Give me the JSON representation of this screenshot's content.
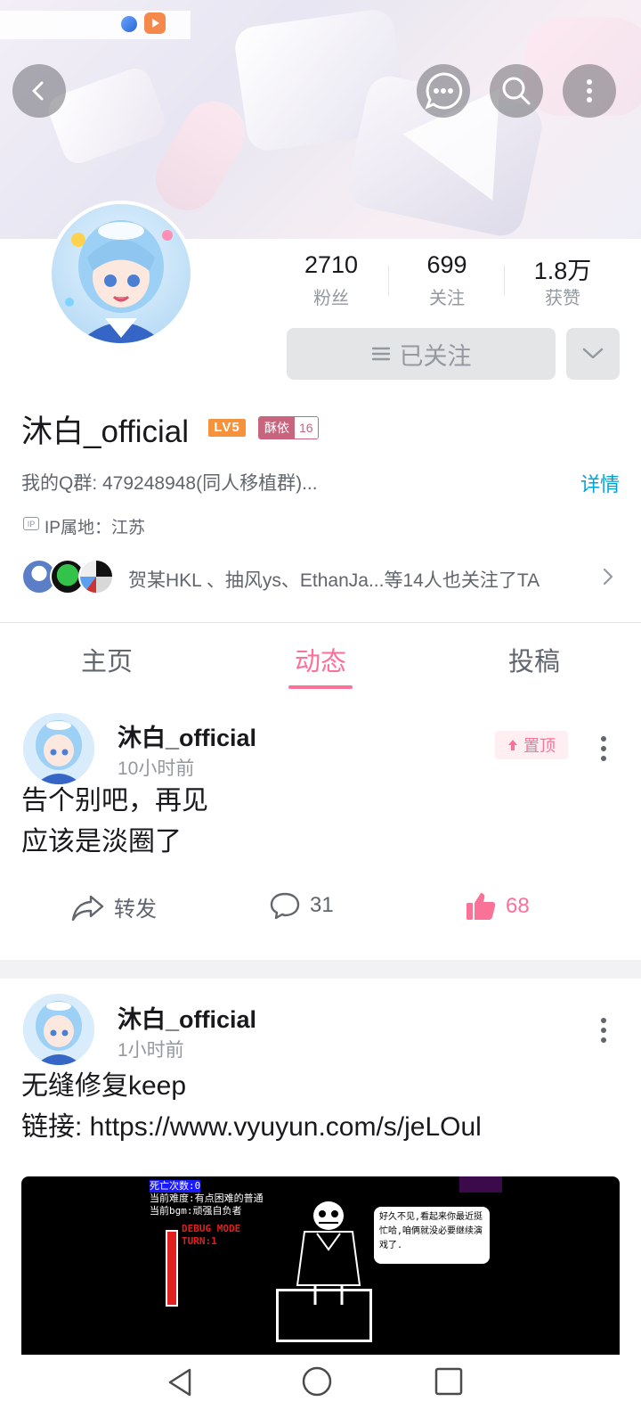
{
  "header": {
    "back_icon": "chevron-left-icon",
    "message_icon": "message-bubble-icon",
    "search_icon": "search-icon",
    "more_icon": "vertical-dots-icon"
  },
  "profile": {
    "stats": [
      {
        "value": "2710",
        "label": "粉丝"
      },
      {
        "value": "699",
        "label": "关注"
      },
      {
        "value": "1.8万",
        "label": "获赞"
      }
    ],
    "follow_button": "已关注",
    "name": "沐白_official",
    "level": "LV5",
    "medal_name": "酥依",
    "medal_level": "16",
    "signature": "我的Q群: 479248948(同人移植群)...",
    "detail_link": "详情",
    "ip_icon_text": "IP",
    "ip_location": "IP属地：江苏",
    "mutual_followers": "贺某HKL 、抽风ys、EthanJa...等14人也关注了TA"
  },
  "tabs": [
    {
      "label": "主页",
      "active": false
    },
    {
      "label": "动态",
      "active": true
    },
    {
      "label": "投稿",
      "active": false
    }
  ],
  "posts": [
    {
      "author": "沐白_official",
      "time": "10小时前",
      "pinned_label": "置顶",
      "text": "告个别吧，再见\n应该是淡圈了",
      "repost_label": "转发",
      "comments": "31",
      "likes": "68"
    },
    {
      "author": "沐白_official",
      "time": "1小时前",
      "text": "无缝修复keep\n链接: https://www.vyuyun.com/s/jeLOul",
      "image": {
        "deaths": "死亡次数:0",
        "difficulty": "当前难度:有点困难的普通",
        "bgm": "当前bgm:顽强自负者",
        "debug": "DEBUG MODE",
        "turn": "TURN:1",
        "dialog": "好久不见,看起来你最近挺忙哈,咱俩就没必要继续演戏了."
      }
    }
  ],
  "colors": {
    "accent": "#fb7299",
    "link": "#00a1d6",
    "level_badge": "#f6923c",
    "medal": "#c7647e"
  }
}
